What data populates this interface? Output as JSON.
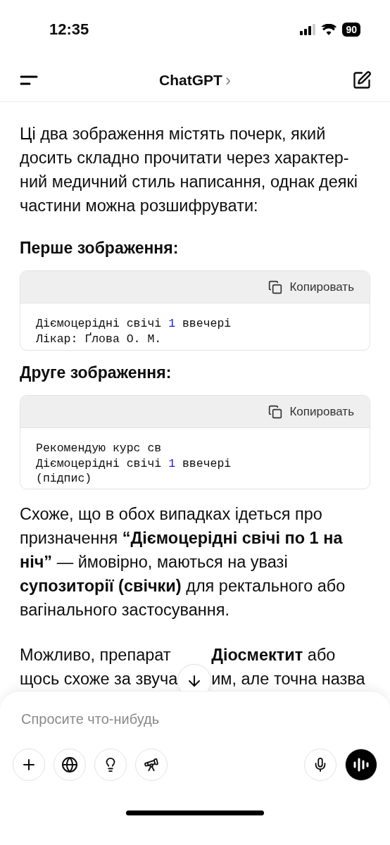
{
  "status_bar": {
    "time": "12:35",
    "battery": "90"
  },
  "header": {
    "title": "ChatGPT",
    "chevron": "›"
  },
  "message": [
    {
      "kind": "paragraph",
      "text": "Ці два зображення містять почерк, який досить складно прочитати через характер-ний медичний стиль написання, однак деякі частини можна розшифрувати:"
    },
    {
      "kind": "heading",
      "text": "Перше зображення:"
    },
    {
      "kind": "code",
      "copy_label": "Копировать",
      "lines": [
        [
          {
            "text": "Діємоцерідні свічі ",
            "kind": "plain"
          },
          {
            "text": "1",
            "kind": "number"
          },
          {
            "text": " ввечері",
            "kind": "plain"
          }
        ],
        [
          {
            "text": "Лікар: Ґлова О. М.",
            "kind": "plain"
          }
        ]
      ]
    },
    {
      "kind": "heading",
      "text": "Друге зображення:"
    },
    {
      "kind": "code",
      "copy_label": "Копировать",
      "lines": [
        [
          {
            "text": "Рекомендую курс св",
            "kind": "plain"
          }
        ],
        [
          {
            "text": "Діємоцерідні свічі ",
            "kind": "plain"
          },
          {
            "text": "1",
            "kind": "number"
          },
          {
            "text": " ввечері",
            "kind": "plain"
          }
        ],
        [
          {
            "text": "(підпис)",
            "kind": "plain"
          }
        ]
      ]
    },
    {
      "kind": "paragraph",
      "text": "Схоже, що в обох випадках ідеться про призначення **“Діємоцерідні свічі по 1 на ніч”** — ймовірно, маються на увазі **супозиторії (свічки)** для ректального або вагінального застосування."
    },
    {
      "kind": "covered",
      "lines": [
        {
          "left": "Можливо, препарат",
          "right": "**Діосмектит** або"
        },
        {
          "left": "щось схоже за звуча",
          "right": "им, але точна назва"
        }
      ]
    }
  ],
  "composer": {
    "placeholder": "Спросите что-нибудь"
  }
}
